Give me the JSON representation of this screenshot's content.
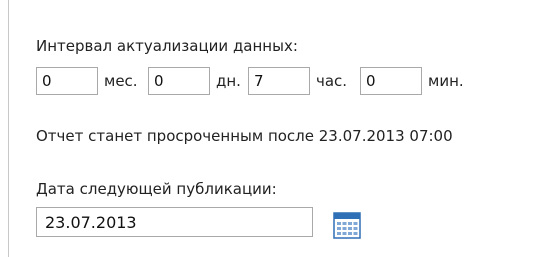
{
  "interval": {
    "label": "Интервал актуализации данных:",
    "months": {
      "value": "0",
      "unit": "мес."
    },
    "days": {
      "value": "0",
      "unit": "дн."
    },
    "hours": {
      "value": "7",
      "unit": "час."
    },
    "minutes": {
      "value": "0",
      "unit": "мин."
    }
  },
  "overdue_text": "Отчет станет просроченным после 23.07.2013 07:00",
  "publication": {
    "label": "Дата следующей публикации:",
    "date_value": "23.07.2013"
  },
  "icons": {
    "calendar": "calendar-icon"
  },
  "colors": {
    "text": "#222222",
    "field_border": "#a9a9a9",
    "calendar_blue": "#2f6fb5"
  }
}
